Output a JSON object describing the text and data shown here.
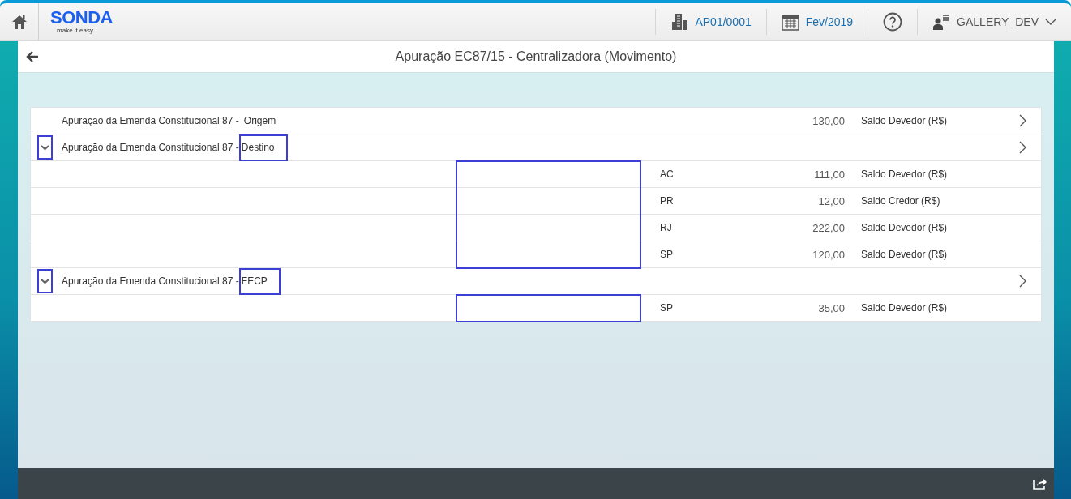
{
  "header": {
    "logo": "SONDA",
    "tagline": "make it easy",
    "company": "AP01/0001",
    "period": "Fev/2019",
    "user": "GALLERY_DEV"
  },
  "page": {
    "title": "Apuração EC87/15 - Centralizadora (Movimento)"
  },
  "groups": [
    {
      "title": "Apuração da Emenda Constitucional 87 -",
      "suffix": "Origem",
      "amount": "130,00",
      "label": "Saldo Devedor (R$)",
      "expanded": false,
      "marked": false
    },
    {
      "title": "Apuração da Emenda Constitucional 87 -",
      "suffix": "Destino",
      "expanded": true,
      "marked": true,
      "children": [
        {
          "state": "AC",
          "amount": "111,00",
          "label": "Saldo Devedor (R$)"
        },
        {
          "state": "PR",
          "amount": "12,00",
          "label": "Saldo Credor (R$)"
        },
        {
          "state": "RJ",
          "amount": "222,00",
          "label": "Saldo Devedor (R$)"
        },
        {
          "state": "SP",
          "amount": "120,00",
          "label": "Saldo Devedor (R$)"
        }
      ]
    },
    {
      "title": "Apuração da Emenda Constitucional 87 -",
      "suffix": "FECP",
      "expanded": true,
      "marked": true,
      "children": [
        {
          "state": "SP",
          "amount": "35,00",
          "label": "Saldo Devedor (R$)"
        }
      ]
    }
  ]
}
